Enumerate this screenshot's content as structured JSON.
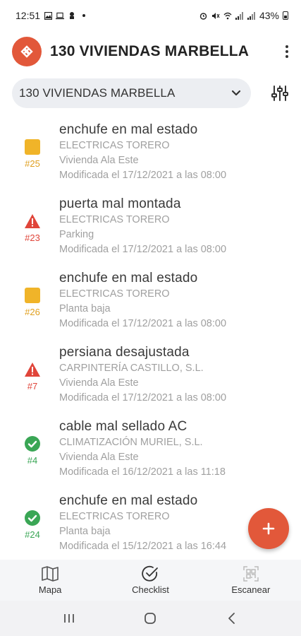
{
  "status_bar": {
    "time": "12:51",
    "battery": "43%",
    "left_icons": [
      "gallery-icon",
      "laptop-icon",
      "notification-icon"
    ],
    "right_icons": [
      "alarm-icon",
      "mute-icon",
      "wifi-icon",
      "signal-icon",
      "signal-icon",
      "battery-icon"
    ]
  },
  "app_bar": {
    "title": "130 VIVIENDAS MARBELLA",
    "logo_icon": "brand-logo",
    "menu_icon": "more-vert-icon",
    "brand_color": "#e2583a"
  },
  "selector": {
    "value": "130 VIVIENDAS MARBELLA",
    "chevron_icon": "chevron-down-icon",
    "filter_icon": "tune-icon"
  },
  "items": [
    {
      "status": "pending",
      "number": "#25",
      "title": "enchufe en mal estado",
      "company": "ELECTRICAS TORERO",
      "location": "Vivienda Ala Este",
      "modified": "Modificada el 17/12/2021 a las 08:00"
    },
    {
      "status": "warning",
      "number": "#23",
      "title": "puerta mal montada",
      "company": "ELECTRICAS TORERO",
      "location": "Parking",
      "modified": "Modificada el 17/12/2021 a las 08:00"
    },
    {
      "status": "pending",
      "number": "#26",
      "title": "enchufe en mal estado",
      "company": "ELECTRICAS TORERO",
      "location": "Planta baja",
      "modified": "Modificada el 17/12/2021 a las 08:00"
    },
    {
      "status": "warning",
      "number": "#7",
      "title": "persiana desajustada",
      "company": "CARPINTERÍA CASTILLO, S.L.",
      "location": "Vivienda Ala Este",
      "modified": "Modificada el 17/12/2021 a las 08:00"
    },
    {
      "status": "done",
      "number": "#4",
      "title": "cable mal sellado AC",
      "company": "CLIMATIZACIÓN MURIEL, S.L.",
      "location": "Vivienda Ala Este",
      "modified": "Modificada el 16/12/2021 a las 11:18"
    },
    {
      "status": "done",
      "number": "#24",
      "title": "enchufe en mal estado",
      "company": "ELECTRICAS TORERO",
      "location": "Planta baja",
      "modified": "Modificada el 15/12/2021 a las 16:44"
    }
  ],
  "status_colors": {
    "pending": "#f0b429",
    "warning": "#e0453a",
    "done": "#3aa655"
  },
  "fab": {
    "icon": "plus-icon",
    "color": "#e2583a"
  },
  "bottom_nav": [
    {
      "label": "Mapa",
      "icon": "map-icon"
    },
    {
      "label": "Checklist",
      "icon": "check-circle-icon"
    },
    {
      "label": "Escanear",
      "icon": "qr-scan-icon"
    }
  ],
  "system_nav": [
    "recents-icon",
    "home-icon",
    "back-icon"
  ]
}
